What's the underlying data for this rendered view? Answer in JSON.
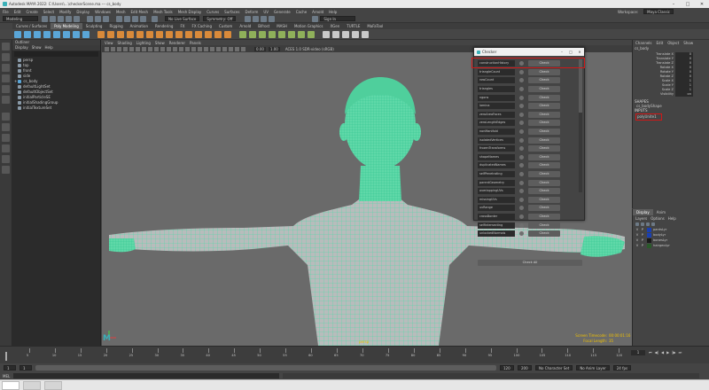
{
  "window": {
    "title": "Autodesk MAYA 2022: C:\\Users\\...\\checkerScene.ma --- cs_body"
  },
  "menubar": {
    "items": [
      "File",
      "Edit",
      "Create",
      "Select",
      "Modify",
      "Display",
      "Windows",
      "Mesh",
      "Edit Mesh",
      "Mesh Tools",
      "Mesh Display",
      "Curves",
      "Surfaces",
      "Deform",
      "UV",
      "Generate",
      "Cache",
      "Arnold",
      "Help"
    ],
    "workspace_label": "Workspace:",
    "workspace_value": "Maya Classic"
  },
  "statusline": {
    "mode": "Modeling",
    "live_surface": "No Live Surface",
    "symmetry": "Symmetry: Off",
    "login": "Sign In"
  },
  "shelf": {
    "tabs": [
      "Curves / Surfaces",
      "Poly Modeling",
      "Sculpting",
      "Rigging",
      "Animation",
      "Rendering",
      "FX",
      "FX Caching",
      "Custom",
      "Arnold",
      "Bifrost",
      "MASH",
      "Motion Graphics",
      "XGen",
      "TURTLE",
      "MaFaTool"
    ],
    "active_tab": "Poly Modeling"
  },
  "outliner": {
    "title": "Outliner",
    "menu": [
      "Display",
      "Show",
      "Help"
    ],
    "items": [
      "persp",
      "top",
      "front",
      "side",
      "cs_body",
      "defaultLightSet",
      "defaultObjectSet",
      "initialParticleSE",
      "initialShadingGroup",
      "initialTextureSet"
    ]
  },
  "viewport": {
    "menu": [
      "View",
      "Shading",
      "Lighting",
      "Show",
      "Renderer",
      "Panels"
    ],
    "color_space": "ACES 1.0 SDR-video (sRGB)",
    "camera_label": "persp",
    "hud": {
      "screen_timecode_label": "Screen Timecode:",
      "screen_timecode": "00:00:01:16",
      "focal_length_label": "Focal Length:",
      "focal_length": "35"
    }
  },
  "checker": {
    "title": "Checker",
    "button_label": "Check",
    "checks": [
      "constructionHistory",
      "triangleCount",
      "rowCount",
      "triangles",
      "ngons",
      "lamina",
      "zeroAreaFaces",
      "zeroLengthEdges",
      "nonManifold",
      "isolatedVertices",
      "frozenTransforms",
      "shapeNames",
      "duplicatedNames",
      "selfPenetrating",
      "parentGeometry",
      "overlappingUVs",
      "missingUVs",
      "uvRange",
      "crossBorder",
      "selfIntersecting",
      "unlockedNormals"
    ],
    "check_all_label": "Check All"
  },
  "channelbox": {
    "menu": [
      "Channels",
      "Edit",
      "Object",
      "Show"
    ],
    "object": "cs_body",
    "attributes": [
      {
        "name": "Translate X",
        "value": "0"
      },
      {
        "name": "Translate Y",
        "value": "0"
      },
      {
        "name": "Translate Z",
        "value": "0"
      },
      {
        "name": "Rotate X",
        "value": "0"
      },
      {
        "name": "Rotate Y",
        "value": "0"
      },
      {
        "name": "Rotate Z",
        "value": "0"
      },
      {
        "name": "Scale X",
        "value": "1"
      },
      {
        "name": "Scale Y",
        "value": "1"
      },
      {
        "name": "Scale Z",
        "value": "1"
      },
      {
        "name": "Visibility",
        "value": "on"
      }
    ],
    "shapes_label": "SHAPES",
    "shape_name": "cs_bodyShape",
    "inputs_label": "INPUTS",
    "input_name": "polyUnite1"
  },
  "layers": {
    "tabs": [
      "Display",
      "Anim"
    ],
    "menu": [
      "Layers",
      "Options",
      "Help"
    ],
    "items": [
      {
        "name": "pantsLyr",
        "color": "#1a3fb0"
      },
      {
        "name": "bodyLyr",
        "color": "#1a3fb0"
      },
      {
        "name": "bonesLyr",
        "color": "#1a1a1a"
      },
      {
        "name": "hairgeoLyr",
        "color": "#2a5a2a"
      }
    ]
  },
  "timeslider": {
    "ticks": [
      "5",
      "10",
      "15",
      "20",
      "25",
      "30",
      "35",
      "40",
      "45",
      "50",
      "55",
      "60",
      "65",
      "70",
      "75",
      "80",
      "85",
      "90",
      "95",
      "100",
      "105",
      "110",
      "115",
      "120"
    ],
    "current_frame": "1"
  },
  "rangeslider": {
    "start": "1",
    "start_inner": "1",
    "end_inner": "120",
    "end": "200",
    "character_set": "No Character Set",
    "anim_layer": "No Anim Layer",
    "fps": "24 fps"
  },
  "cmdline": {
    "lang": "MEL"
  },
  "colors": {
    "accent_red": "#d01818",
    "wire": "#3de0a5",
    "hud_yellow": "#f0c000"
  }
}
